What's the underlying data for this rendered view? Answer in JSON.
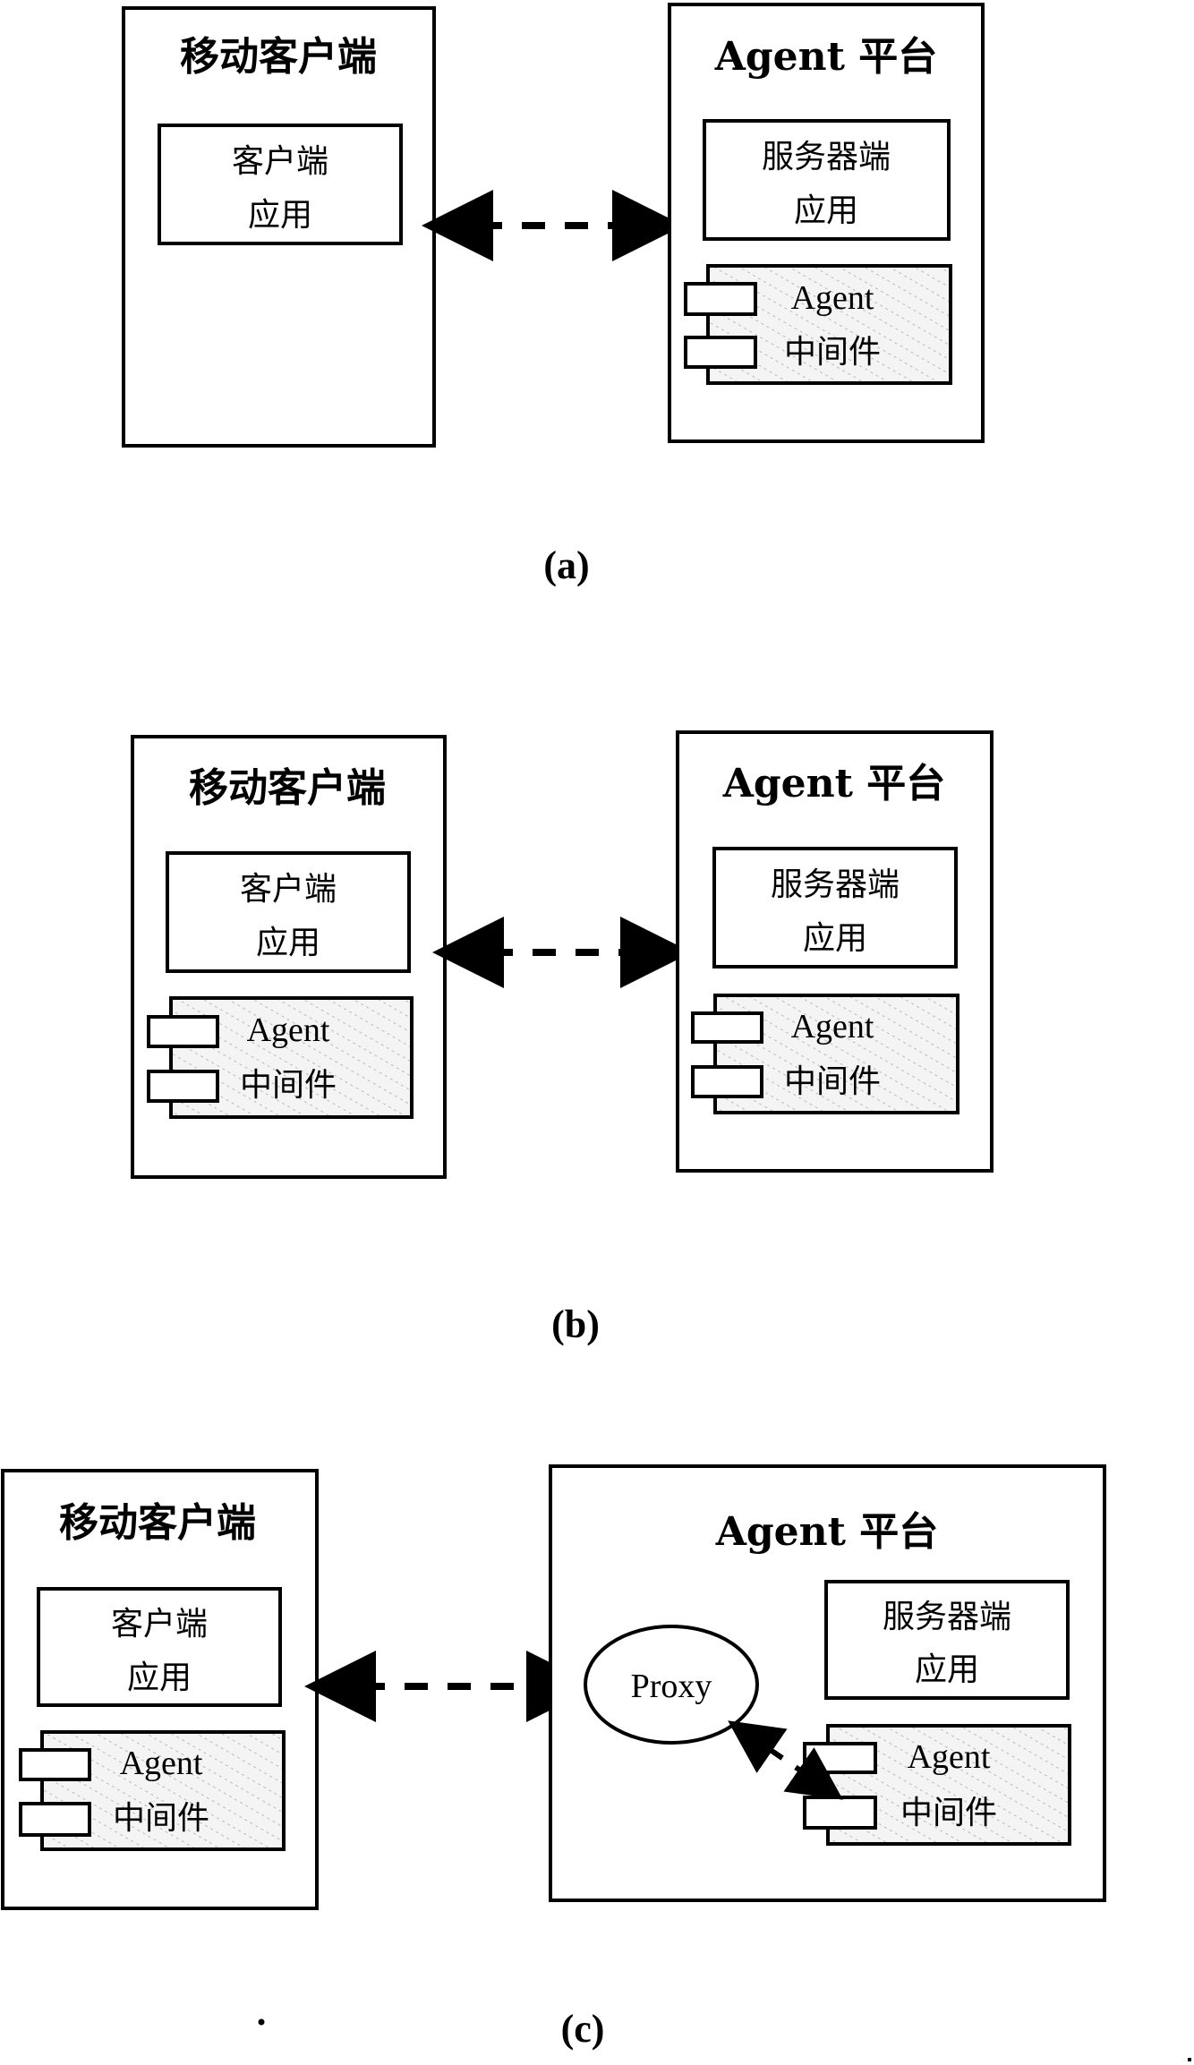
{
  "figure": {
    "panels": [
      {
        "caption": "(a)",
        "client": {
          "title": "移动客户端",
          "app_line1": "客户端",
          "app_line2": "应用",
          "middleware": null
        },
        "platform": {
          "title": "Agent 平台",
          "app_line1": "服务器端",
          "app_line2": "应用",
          "middleware_line1": "Agent",
          "middleware_line2": "中间件"
        },
        "connection": "bidirectional-dashed"
      },
      {
        "caption": "(b)",
        "client": {
          "title": "移动客户端",
          "app_line1": "客户端",
          "app_line2": "应用",
          "middleware_line1": "Agent",
          "middleware_line2": "中间件"
        },
        "platform": {
          "title": "Agent 平台",
          "app_line1": "服务器端",
          "app_line2": "应用",
          "middleware_line1": "Agent",
          "middleware_line2": "中间件"
        },
        "connection": "bidirectional-dashed"
      },
      {
        "caption": "(c)",
        "client": {
          "title": "移动客户端",
          "app_line1": "客户端",
          "app_line2": "应用",
          "middleware_line1": "Agent",
          "middleware_line2": "中间件"
        },
        "platform": {
          "title": "Agent 平台",
          "proxy_label": "Proxy",
          "app_line1": "服务器端",
          "app_line2": "应用",
          "middleware_line1": "Agent",
          "middleware_line2": "中间件"
        },
        "connection": "bidirectional-dashed-via-proxy"
      }
    ]
  }
}
